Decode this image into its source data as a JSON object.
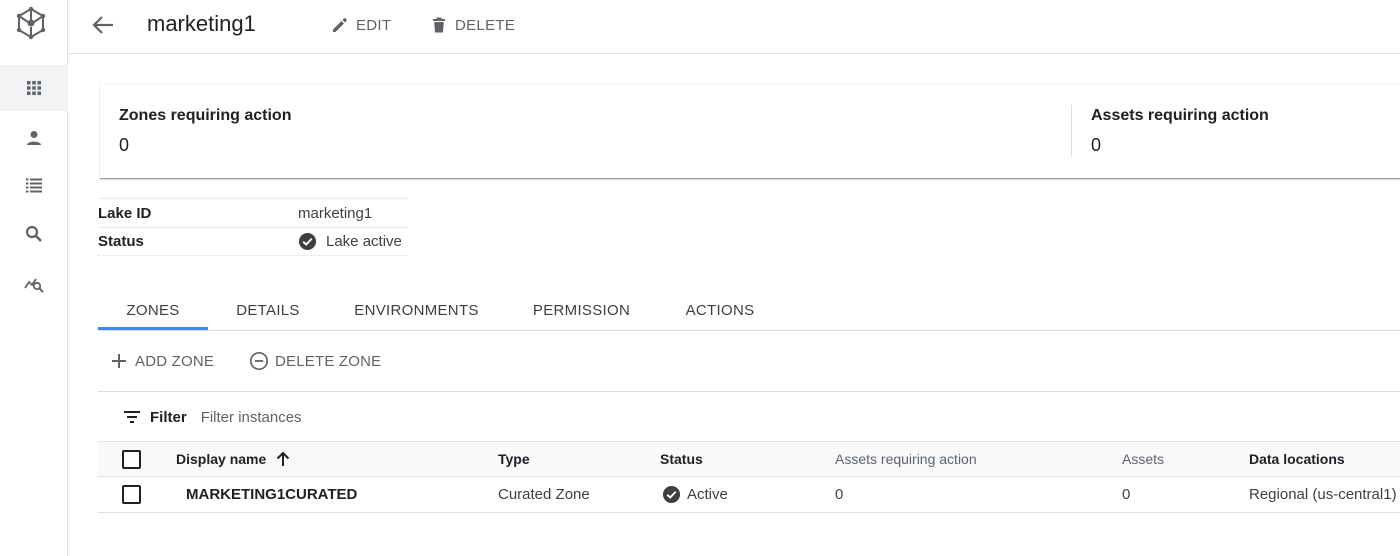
{
  "header": {
    "title": "marketing1",
    "edit_label": "EDIT",
    "delete_label": "DELETE"
  },
  "summary": {
    "zones_label": "Zones requiring action",
    "zones_value": "0",
    "assets_label": "Assets requiring action",
    "assets_value": "0"
  },
  "lake_info": {
    "lake_id_label": "Lake ID",
    "lake_id_value": "marketing1",
    "status_label": "Status",
    "status_value": "Lake active"
  },
  "tabs": [
    {
      "label": "ZONES",
      "active": true
    },
    {
      "label": "DETAILS",
      "active": false
    },
    {
      "label": "ENVIRONMENTS",
      "active": false
    },
    {
      "label": "PERMISSION",
      "active": false
    },
    {
      "label": "ACTIONS",
      "active": false
    }
  ],
  "zone_actions": {
    "add_label": "ADD ZONE",
    "delete_label": "DELETE ZONE"
  },
  "filter": {
    "label": "Filter",
    "placeholder": "Filter instances"
  },
  "table": {
    "columns": {
      "display_name": "Display name",
      "type": "Type",
      "status": "Status",
      "assets_requiring_action": "Assets requiring action",
      "assets": "Assets",
      "data_locations": "Data locations"
    },
    "rows": [
      {
        "display_name": "MARKETING1CURATED",
        "type": "Curated Zone",
        "status": "Active",
        "assets_requiring_action": "0",
        "assets": "0",
        "data_locations": "Regional (us-central1)"
      }
    ]
  },
  "colors": {
    "accent": "#4285f4",
    "icon_gray": "#5f6368",
    "text_dark": "#202124"
  }
}
